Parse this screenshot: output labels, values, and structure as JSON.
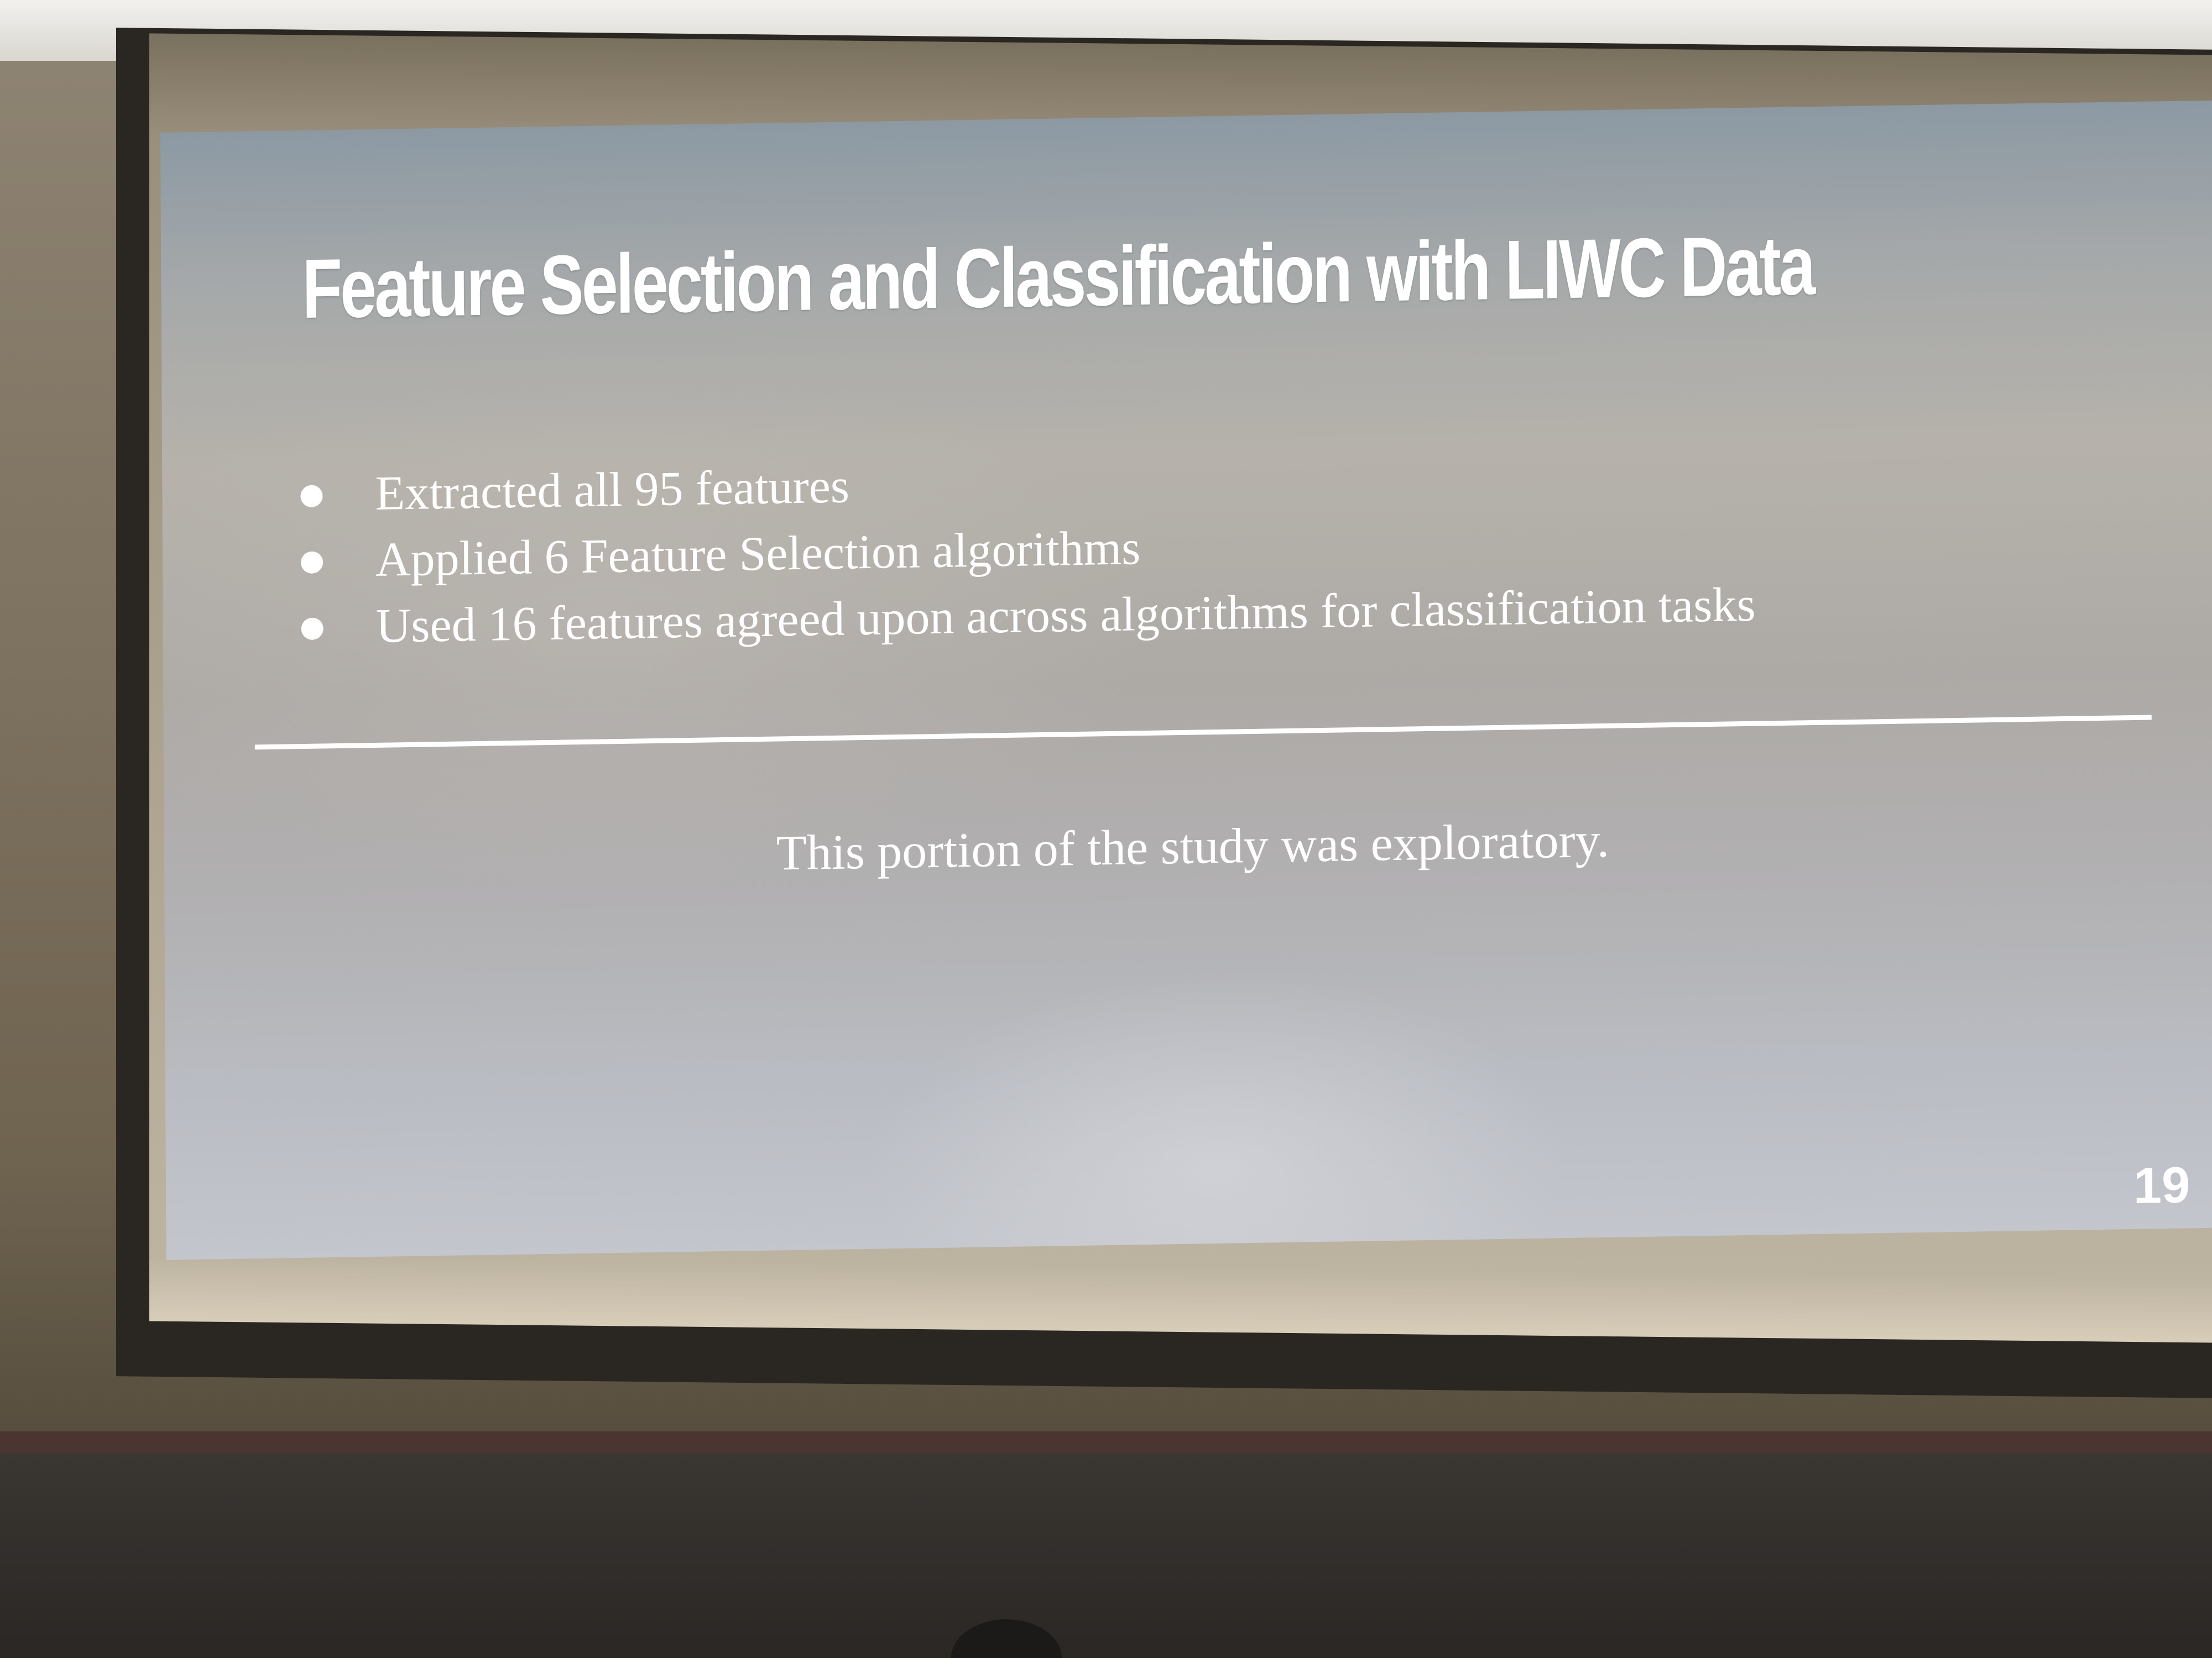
{
  "slide": {
    "title": "Feature Selection and Classification with LIWC Data",
    "bullets": [
      "Extracted all 95 features",
      "Applied 6 Feature Selection algorithms",
      "Used 16 features agreed upon across algorithms for classification tasks"
    ],
    "note": "This portion of the study was exploratory.",
    "page_number": "19"
  },
  "colors": {
    "slide_text": "#ffffff",
    "slide_background": "#b0aea9",
    "room_wall": "#7d715f"
  }
}
